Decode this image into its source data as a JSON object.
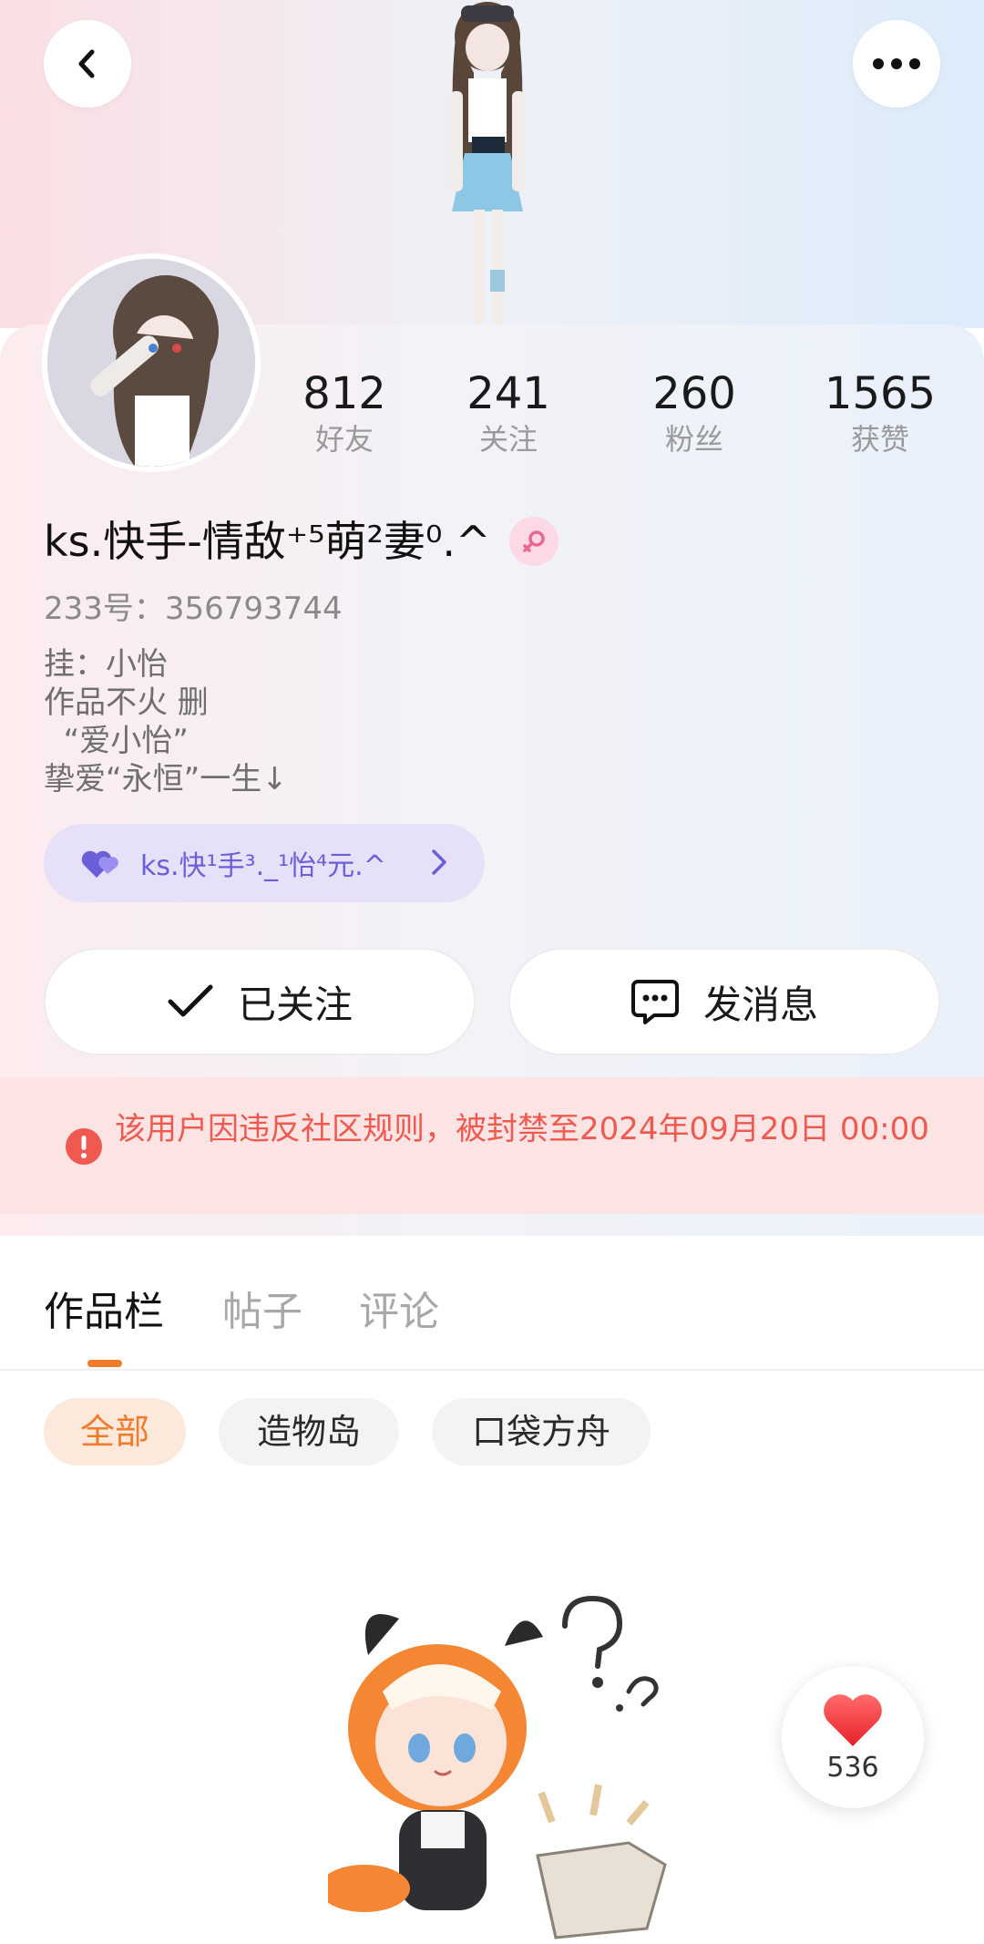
{
  "profile": {
    "name": "ks.快手-情敌⁺⁵萌²妻⁰.^",
    "uid": "233号：356793744",
    "bio": [
      "挂：小怡",
      "作品不火 删",
      "  “爱小怡”",
      "挚爱“永恒”一生↓"
    ],
    "family_label": "ks.快¹手³._¹怡⁴元.^"
  },
  "stats": [
    {
      "value": "812",
      "label": "好友"
    },
    {
      "value": "241",
      "label": "关注"
    },
    {
      "value": "260",
      "label": "粉丝"
    },
    {
      "value": "1565",
      "label": "获赞"
    }
  ],
  "actions": {
    "follow_label": "已关注",
    "message_label": "发消息"
  },
  "ban_notice": "该用户因违反社区规则，被封禁至2024年09月20日 00:00",
  "tabs": [
    "作品栏",
    "帖子",
    "评论"
  ],
  "filters": [
    "全部",
    "造物岛",
    "口袋方舟"
  ],
  "like_count": "536",
  "colors": {
    "accent": "#f07c2b",
    "ban_text": "#ee5a4f",
    "ban_bg": "#fde4e4",
    "family_text": "#6a5fd8",
    "gender_pink": "#e8698f"
  },
  "icons": [
    "back-arrow-icon",
    "more-dots-icon",
    "female-gender-icon",
    "double-heart-icon",
    "chevron-right-icon",
    "check-icon",
    "chat-bubble-icon",
    "alert-icon",
    "heart-icon"
  ]
}
